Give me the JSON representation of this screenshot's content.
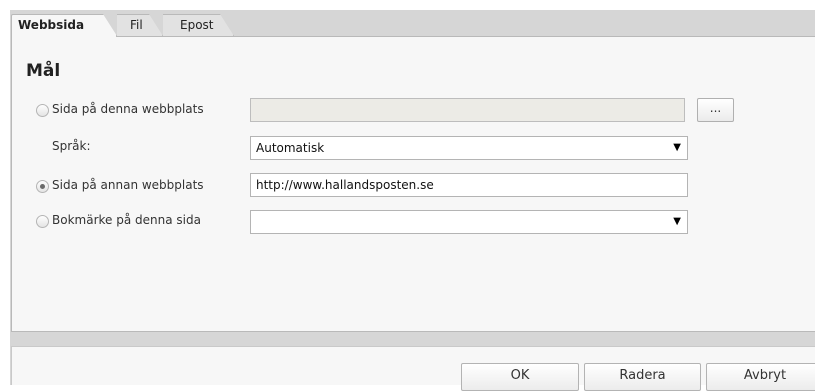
{
  "tabs": [
    {
      "label": "Webbsida"
    },
    {
      "label": "Fil"
    },
    {
      "label": "Epost"
    }
  ],
  "heading": "Mål",
  "rows": {
    "page_this_site": {
      "label": "Sida på denna webbplats",
      "value": "",
      "checked": false
    },
    "language": {
      "label": "Språk:",
      "value": "Automatisk"
    },
    "page_other_site": {
      "label": "Sida på annan webbplats",
      "value": "http://www.hallandsposten.se",
      "checked": true
    },
    "bookmark": {
      "label": "Bokmärke på denna sida",
      "value": "",
      "checked": false
    }
  },
  "browse_label": "...",
  "dropdown_arrow": "▼",
  "buttons": {
    "ok": "OK",
    "delete": "Radera",
    "cancel": "Avbryt"
  },
  "colors": {
    "dialog_bg": "#d6d6d6",
    "panel_bg": "#f7f7f7",
    "disabled_field_bg": "#ecebe6"
  }
}
